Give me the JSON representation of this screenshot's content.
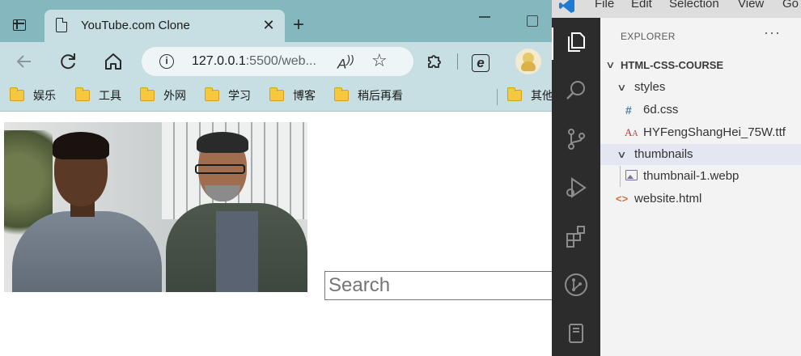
{
  "browser": {
    "tab": {
      "title": "YouTube.com Clone",
      "close_glyph": "✕"
    },
    "new_tab_glyph": "+",
    "toolbar": {
      "url_host": "127.0.0.1",
      "url_rest": ":5500/web...",
      "read_aloud_glyph": "A))",
      "favorite_glyph": "☆"
    },
    "bookmarks": [
      {
        "label": "娱乐"
      },
      {
        "label": "工具"
      },
      {
        "label": "外网"
      },
      {
        "label": "学习"
      },
      {
        "label": "博客"
      },
      {
        "label": "稍后再看"
      },
      {
        "label": "其他"
      }
    ]
  },
  "page": {
    "search": {
      "placeholder": "Search"
    }
  },
  "vscode": {
    "menu": [
      "File",
      "Edit",
      "Selection",
      "View",
      "Go"
    ],
    "explorer": {
      "title": "EXPLORER",
      "more": "···",
      "project": "HTML-CSS-COURSE",
      "tree": {
        "styles_folder": "styles",
        "css_file": "6d.css",
        "font_file": "HYFengShangHei_75W.ttf",
        "thumbnails_folder": "thumbnails",
        "thumb_file": "thumbnail-1.webp",
        "html_file": "website.html"
      },
      "icons": {
        "css": "#",
        "ttf": "A",
        "html": "<>"
      }
    }
  },
  "colors": {
    "tabbar": "#85b7bf",
    "toolbar": "#c7dfe2",
    "vscode_activitybar": "#2c2c2c",
    "vscode_sidebar": "#f3f3f3",
    "selected_row": "#e4e6f1"
  }
}
